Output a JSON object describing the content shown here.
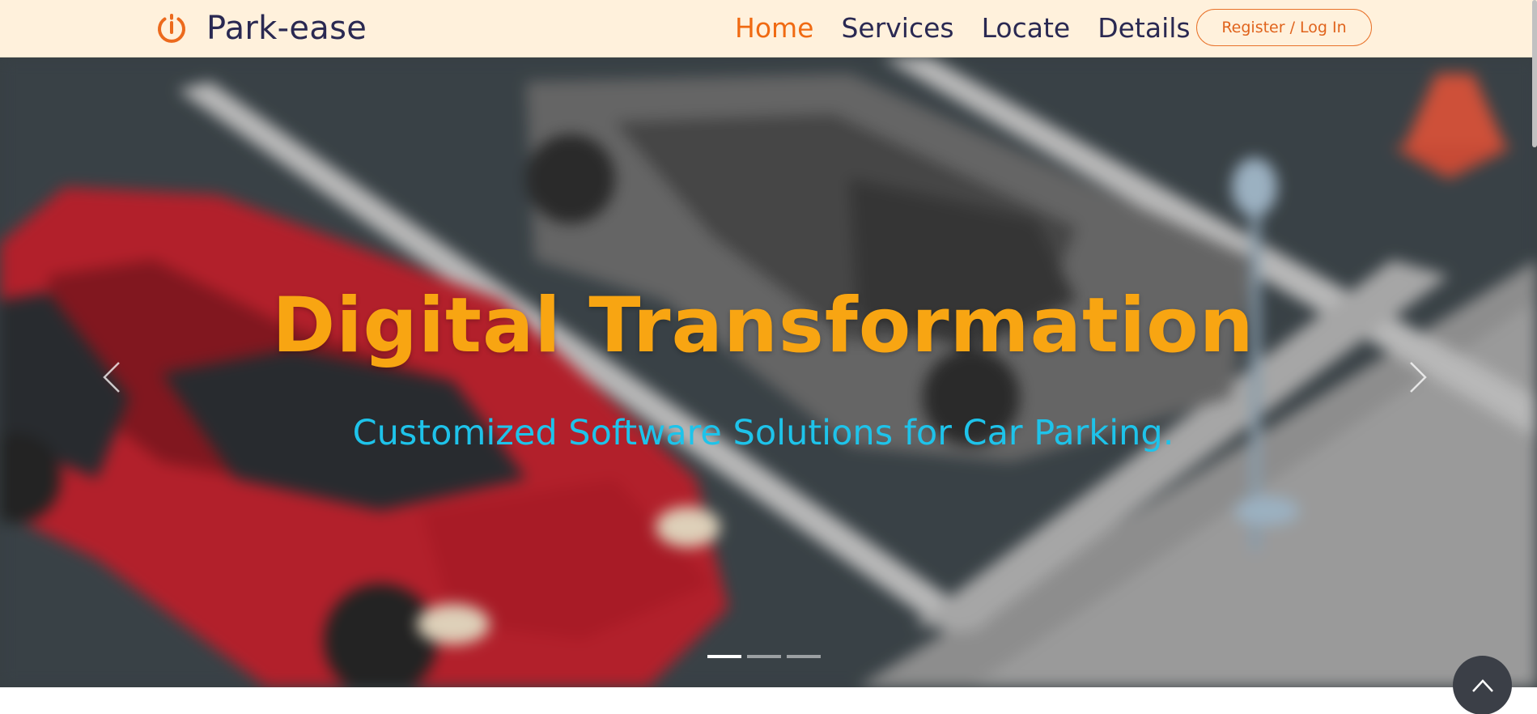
{
  "brand": {
    "name": "Park-ease",
    "logo_icon": "power-icon",
    "accent_color": "#f06a12"
  },
  "nav": {
    "items": [
      {
        "label": "Home",
        "active": true
      },
      {
        "label": "Services",
        "active": false
      },
      {
        "label": "Locate",
        "active": false
      },
      {
        "label": "Details",
        "active": false
      }
    ],
    "login_label": "Register / Log In"
  },
  "hero": {
    "title": "Digital Transformation",
    "subtitle": "Customized Software Solutions for Car Parking.",
    "title_color": "#f8a512",
    "subtitle_color": "#1ec3ea",
    "prev_icon": "chevron-left-icon",
    "next_icon": "chevron-right-icon",
    "slides_count": 3,
    "active_slide": 1
  },
  "back_to_top_icon": "chevron-up-icon"
}
